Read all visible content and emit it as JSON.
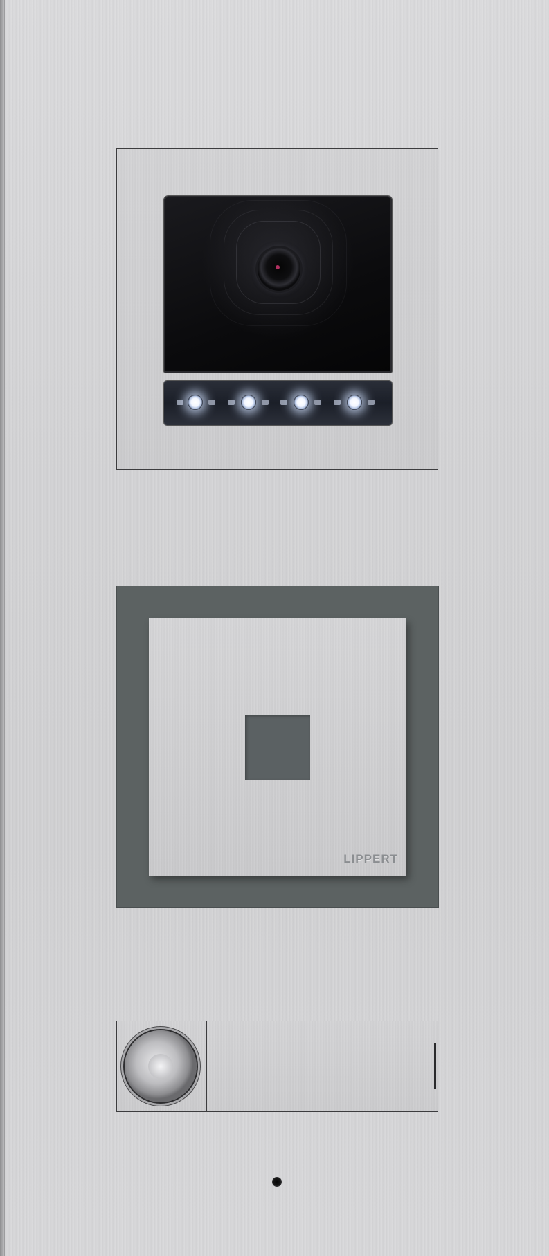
{
  "device": {
    "type": "door intercom station",
    "brand_logo": "LIPPERT"
  },
  "camera_module": {
    "lens_icon": "camera-lens-icon",
    "led_count": 4,
    "led_color": "#ffffff"
  },
  "reader_module": {
    "icon": "rfid-reader-icon",
    "frame_color": "#5c6262"
  },
  "bell_module": {
    "button_icon": "bell-push-button-icon",
    "name_plate_text": ""
  },
  "microphone": {
    "icon": "microphone-hole-icon"
  },
  "colors": {
    "panel": "#d3d3d5",
    "frame_dark": "#5c6262",
    "led_glow": "#e6eeff"
  }
}
